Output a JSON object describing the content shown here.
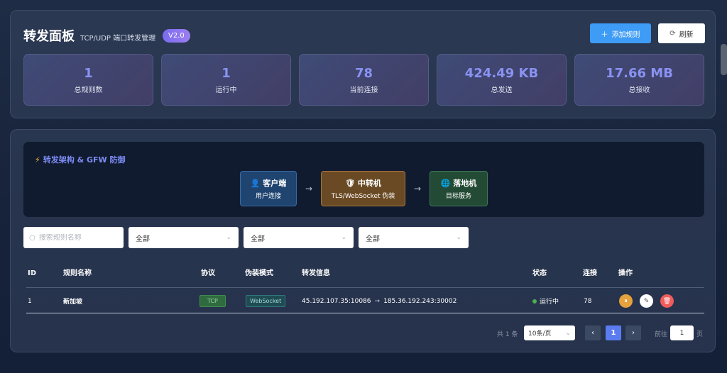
{
  "header": {
    "title": "转发面板",
    "subtitle": "TCP/UDP 端口转发管理",
    "version": "V2.0",
    "add_button": "添加规则",
    "refresh_button": "刷新"
  },
  "stats": [
    {
      "value": "1",
      "label": "总规则数"
    },
    {
      "value": "1",
      "label": "运行中"
    },
    {
      "value": "78",
      "label": "当前连接"
    },
    {
      "value": "424.49 KB",
      "label": "总发送"
    },
    {
      "value": "17.66 MB",
      "label": "总接收"
    }
  ],
  "architecture": {
    "title": "转发架构 & GFW 防御",
    "nodes": [
      {
        "name": "客户端",
        "desc": "用户连接"
      },
      {
        "name": "中转机",
        "desc": "TLS/WebSocket 伪装"
      },
      {
        "name": "落地机",
        "desc": "目标服务"
      }
    ],
    "arrow": "→"
  },
  "filters": {
    "search_placeholder": "搜索规则名称",
    "select1": "全部",
    "select2": "全部",
    "select3": "全部"
  },
  "table": {
    "headers": [
      "ID",
      "规则名称",
      "协议",
      "伪装模式",
      "转发信息",
      "状态",
      "连接",
      "操作"
    ],
    "rows": [
      {
        "id": "1",
        "name": "新加坡",
        "protocol": "TCP",
        "mode": "WebSocket",
        "source": "45.192.107.35:10086",
        "arrow": "→",
        "target": "185.36.192.243:30002",
        "status": "运行中",
        "connections": "78"
      }
    ]
  },
  "pagination": {
    "total": "共 1 条",
    "page_size": "10条/页",
    "current_page": "1",
    "goto_prefix": "前往",
    "goto_value": "1",
    "goto_suffix": "页"
  },
  "colors": {
    "accent": "#3f9cf6",
    "stat_value": "#8a92f2",
    "status_running": "#4caf50"
  }
}
